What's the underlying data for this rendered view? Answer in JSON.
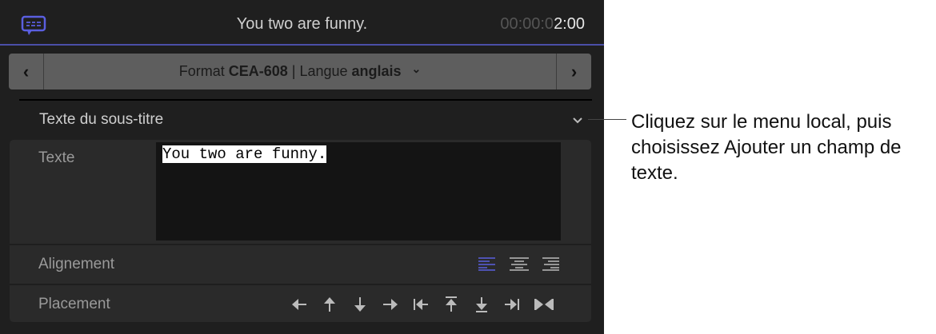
{
  "header": {
    "title": "You two are funny.",
    "timecode_dim": "00:00:0",
    "timecode_bright": "2:00",
    "caption_icon": "caption-bubble-icon"
  },
  "nav": {
    "prev": "‹",
    "next": "›",
    "format_label": "Format",
    "format_value": "CEA-608",
    "separator": "|",
    "language_label": "Langue",
    "language_value": "anglais",
    "chevron": "⌄"
  },
  "section": {
    "title": "Texte du sous-titre",
    "chevron": "⌄"
  },
  "fields": {
    "text_label": "Texte",
    "text_value": "You two are funny.",
    "alignment_label": "Alignement",
    "placement_label": "Placement"
  },
  "alignment": {
    "selected": "left",
    "options": [
      "left",
      "center",
      "right"
    ]
  },
  "placement": [
    "left",
    "up",
    "down",
    "right",
    "far-left",
    "top",
    "bottom",
    "far-right",
    "center"
  ],
  "colors": {
    "accent": "#5a5fe0",
    "panel": "#1f1f1f"
  },
  "callout": "Cliquez sur le menu local, puis choisissez Ajouter un champ de texte."
}
